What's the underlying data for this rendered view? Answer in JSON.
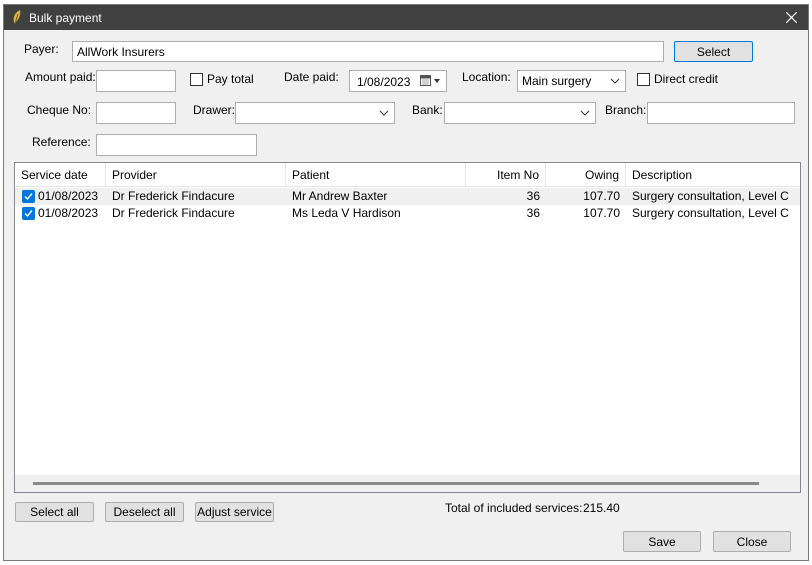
{
  "window": {
    "title": "Bulk payment"
  },
  "payer": {
    "label": "Payer:",
    "value": "AllWork Insurers",
    "select_label": "Select"
  },
  "amount_paid": {
    "label": "Amount paid:",
    "value": ""
  },
  "pay_total": {
    "label": "Pay total",
    "checked": false
  },
  "date_paid": {
    "label": "Date paid:",
    "value": "1/08/2023"
  },
  "location": {
    "label": "Location:",
    "value": "Main surgery"
  },
  "direct_credit": {
    "label": "Direct credit",
    "checked": false
  },
  "cheque_no": {
    "label": "Cheque No:",
    "value": ""
  },
  "drawer": {
    "label": "Drawer:",
    "value": ""
  },
  "bank": {
    "label": "Bank:",
    "value": ""
  },
  "branch": {
    "label": "Branch:",
    "value": ""
  },
  "reference": {
    "label": "Reference:",
    "value": ""
  },
  "grid": {
    "columns": {
      "service_date": "Service date",
      "provider": "Provider",
      "patient": "Patient",
      "item_no": "Item No",
      "owing": "Owing",
      "description": "Description"
    },
    "rows": [
      {
        "checked": true,
        "service_date": "01/08/2023",
        "provider": "Dr Frederick Findacure",
        "patient": "Mr Andrew Baxter",
        "item_no": "36",
        "owing": "107.70",
        "description": "Surgery consultation, Level C"
      },
      {
        "checked": true,
        "service_date": "01/08/2023",
        "provider": "Dr Frederick Findacure",
        "patient": "Ms Leda V Hardison",
        "item_no": "36",
        "owing": "107.70",
        "description": "Surgery consultation, Level C"
      }
    ]
  },
  "buttons": {
    "select_all": "Select all",
    "deselect_all": "Deselect all",
    "adjust_service": "Adjust service",
    "save": "Save",
    "close": "Close"
  },
  "total": {
    "label": "Total of included services:",
    "value": "215.40"
  },
  "colors": {
    "titlebar": "#404040",
    "accent": "#0078d7",
    "alt_row": "#f0f0f0"
  }
}
